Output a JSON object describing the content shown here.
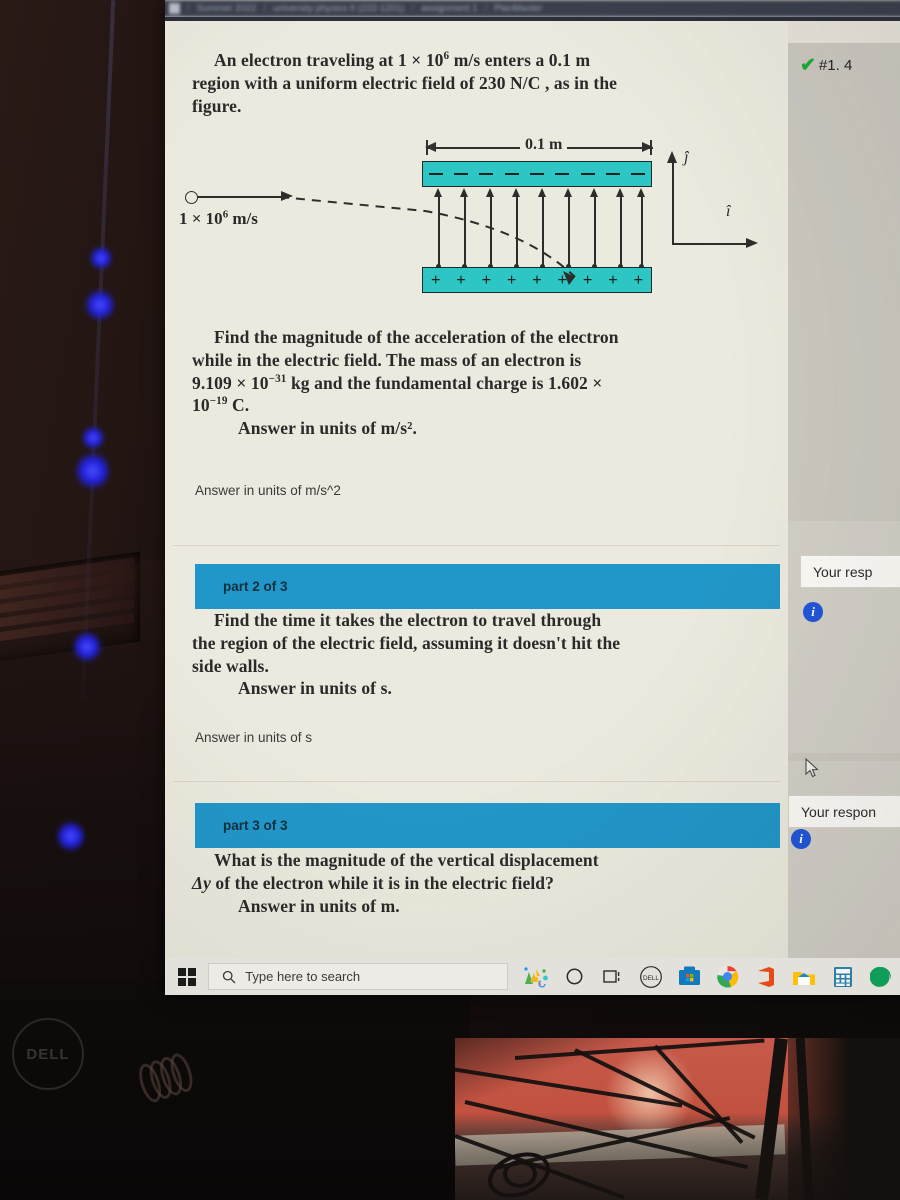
{
  "breadcrumb": {
    "home_icon": "home-icon",
    "items": [
      "Summer 2022",
      "university physics II (222-1201)",
      "assignment 1",
      "PlanMaster"
    ],
    "separator": "/"
  },
  "problem1": {
    "status_check": "✔",
    "status_label": "#1. 4",
    "statement_lines": [
      "An electron traveling at 1 × 10⁶ m/s enters",
      "a 0.1 m region with a uniform electric field of",
      "230 N/C , as in the figure."
    ],
    "statement_html": "An electron traveling at 1 × 10<sup>6</sup> m/s enters a 0.1 m region with a uniform electric field of 230 N/C , as in the figure.",
    "question_html": "Find the magnitude of the acceleration of the electron while in the electric field.  The mass of an electron is 9.109 × 10<sup>−31</sup> kg and the fundamental charge is 1.602 × 10<sup>−19</sup> C.",
    "answer_units_inline": "Answer in units of  m/s².",
    "answer_units_field": "Answer in units of m/s^2"
  },
  "figure": {
    "dimension_label": "0.1 m",
    "velocity_label": "1 × 10⁶ m/s",
    "velocity_label_html": "1 × 10<sup>6</sup> m/s",
    "top_plate_sign": "−",
    "bottom_plate_sign": "+",
    "field_line_count": 9,
    "axis_vertical_label": "ĵ",
    "axis_horizontal_label": "î",
    "electron_icon": "electron-icon",
    "plate_color": "#2ec6c4",
    "region_width_m": 0.1,
    "field_strength": "230 N/C",
    "initial_speed": "1 × 10^6 m/s"
  },
  "problem2": {
    "part_label": "part 2 of 3",
    "question_html": "Find the time it takes the electron to travel through the region of the electric field, assuming it doesn't hit the side walls.",
    "answer_units_inline": "Answer in units of  s.",
    "answer_units_field": "Answer in units of s",
    "response_box_label": "Your resp",
    "info_icon": "i"
  },
  "problem3": {
    "part_label": "part 3 of 3",
    "question_html": "What is the magnitude of the vertical displacement <i>Δy</i> of the electron while it is in the electric field?",
    "answer_units_inline": "Answer in units of  m.",
    "answer_units_field": "Answer in units of m",
    "response_box_label": "Your respon",
    "info_icon": "i"
  },
  "colors": {
    "part_bar": "#2197c9",
    "plate_teal": "#2ec6c4",
    "check_green": "#1faa3c",
    "info_blue": "#2156d8",
    "page_bg": "#eceade"
  },
  "taskbar": {
    "start_icon": "windows-start-icon",
    "search_placeholder": "Type here to search",
    "search_icon": "search-icon",
    "icons": [
      {
        "name": "paint-3d-icon",
        "glyph": "🎨"
      },
      {
        "name": "cortana-icon",
        "glyph": "◯"
      },
      {
        "name": "task-view-icon",
        "glyph": "❏"
      },
      {
        "name": "dell-icon",
        "glyph": "DELL"
      },
      {
        "name": "microsoft-store-icon",
        "glyph": "▣"
      },
      {
        "name": "chrome-icon",
        "glyph": "◉"
      },
      {
        "name": "office-icon",
        "glyph": "◧"
      },
      {
        "name": "file-explorer-icon",
        "glyph": "🗂"
      },
      {
        "name": "calculator-icon",
        "glyph": "▦"
      },
      {
        "name": "edge-icon",
        "glyph": "◉"
      }
    ]
  },
  "desk": {
    "monitor_brand": "DELL"
  }
}
